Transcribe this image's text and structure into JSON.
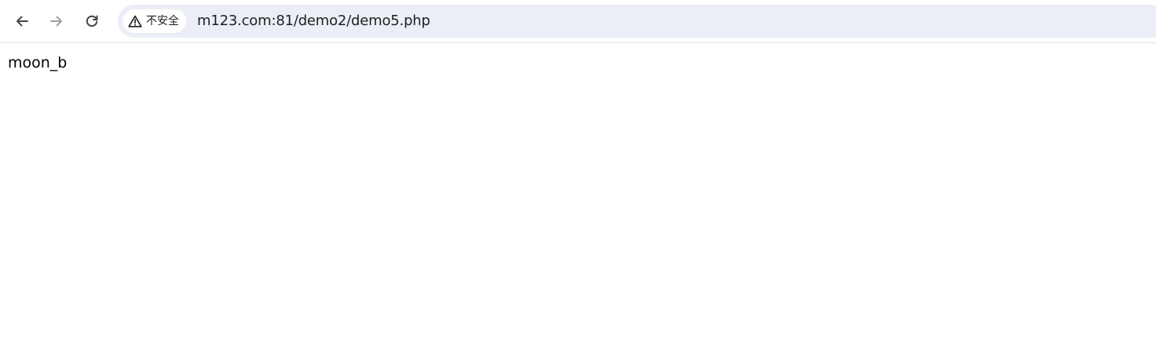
{
  "browser": {
    "security_label": "不安全",
    "url": "m123.com:81/demo2/demo5.php",
    "icons": {
      "back": "arrow-left-icon",
      "forward": "arrow-right-icon",
      "reload": "reload-icon",
      "security": "warning-triangle-icon"
    },
    "colors": {
      "omnibox_bg": "#ebeef6",
      "forward_disabled": "#9aa0a6",
      "icon_active": "#474747"
    }
  },
  "page": {
    "body_text": "moon_b"
  }
}
